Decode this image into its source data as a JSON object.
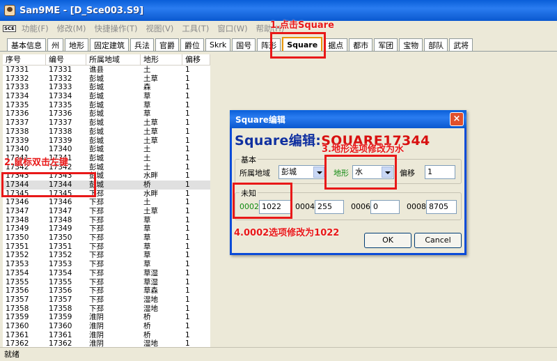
{
  "window": {
    "title": "San9ME - [D_Sce003.S9]"
  },
  "menu": {
    "logo": "SCE",
    "items": [
      "功能(F)",
      "修改(M)",
      "快捷操作(T)",
      "视图(V)",
      "工具(T)",
      "窗口(W)",
      "帮助(H)"
    ]
  },
  "tabs": [
    "基本信息",
    "州",
    "地形",
    "固定建筑",
    "兵法",
    "官爵",
    "爵位",
    "Skrk",
    "国号",
    "阵形",
    "Square",
    "据点",
    "都市",
    "军团",
    "宝物",
    "部队",
    "武将"
  ],
  "active_tab": "Square",
  "list": {
    "columns": [
      "序号",
      "编号",
      "所属地域",
      "地形",
      "偏移"
    ],
    "rows": [
      [
        "17331",
        "17331",
        "谯县",
        "土",
        "1"
      ],
      [
        "17332",
        "17332",
        "彭城",
        "土草",
        "1"
      ],
      [
        "17333",
        "17333",
        "彭城",
        "森",
        "1"
      ],
      [
        "17334",
        "17334",
        "彭城",
        "草",
        "1"
      ],
      [
        "17335",
        "17335",
        "彭城",
        "草",
        "1"
      ],
      [
        "17336",
        "17336",
        "彭城",
        "草",
        "1"
      ],
      [
        "17337",
        "17337",
        "彭城",
        "土草",
        "1"
      ],
      [
        "17338",
        "17338",
        "彭城",
        "土草",
        "1"
      ],
      [
        "17339",
        "17339",
        "彭城",
        "土草",
        "1"
      ],
      [
        "17340",
        "17340",
        "彭城",
        "土",
        "1"
      ],
      [
        "17341",
        "17341",
        "彭城",
        "土",
        "1"
      ],
      [
        "17342",
        "17342",
        "彭城",
        "土",
        "1"
      ],
      [
        "17343",
        "17343",
        "彭城",
        "水畔",
        "1"
      ],
      [
        "17344",
        "17344",
        "彭城",
        "桥",
        "1"
      ],
      [
        "17345",
        "17345",
        "下邳",
        "水畔",
        "1"
      ],
      [
        "17346",
        "17346",
        "下邳",
        "土",
        "1"
      ],
      [
        "17347",
        "17347",
        "下邳",
        "土草",
        "1"
      ],
      [
        "17348",
        "17348",
        "下邳",
        "草",
        "1"
      ],
      [
        "17349",
        "17349",
        "下邳",
        "草",
        "1"
      ],
      [
        "17350",
        "17350",
        "下邳",
        "草",
        "1"
      ],
      [
        "17351",
        "17351",
        "下邳",
        "草",
        "1"
      ],
      [
        "17352",
        "17352",
        "下邳",
        "草",
        "1"
      ],
      [
        "17353",
        "17353",
        "下邳",
        "草",
        "1"
      ],
      [
        "17354",
        "17354",
        "下邳",
        "草湿",
        "1"
      ],
      [
        "17355",
        "17355",
        "下邳",
        "草湿",
        "1"
      ],
      [
        "17356",
        "17356",
        "下邳",
        "草森",
        "1"
      ],
      [
        "17357",
        "17357",
        "下邳",
        "湿地",
        "1"
      ],
      [
        "17358",
        "17358",
        "下邳",
        "湿地",
        "1"
      ],
      [
        "17359",
        "17359",
        "淮阴",
        "桥",
        "1"
      ],
      [
        "17360",
        "17360",
        "淮阴",
        "桥",
        "1"
      ],
      [
        "17361",
        "17361",
        "淮阴",
        "桥",
        "1"
      ],
      [
        "17362",
        "17362",
        "淮阴",
        "湿地",
        "1"
      ]
    ],
    "selected_index": 13
  },
  "status": {
    "text": "就绪"
  },
  "dialog": {
    "title": "Square编辑",
    "heading_prefix": "Square编辑:",
    "heading_id": "SQUARE17344",
    "group_basic": "基本",
    "region_label": "所属地域",
    "region_value": "彭城",
    "terrain_label": "地形",
    "terrain_value": "水",
    "offset_label": "偏移",
    "offset_value": "1",
    "group_unknown": "未知",
    "f0002_label": "0002",
    "f0002_value": "1022",
    "f0004_label": "0004",
    "f0004_value": "255",
    "f0006_label": "0006",
    "f0006_value": "0",
    "f0008_label": "0008",
    "f0008_value": "8705",
    "ok_label": "OK",
    "cancel_label": "Cancel"
  },
  "annotations": {
    "step1": "1.点击Square",
    "step2": "2.鼠标双击左键",
    "step3": "3.地形选项修改为水",
    "step4": "4.0002选项修改为1022"
  },
  "colors": {
    "annotation": "#e81818",
    "title_blue": "#0a5fd8",
    "heading_blue": "#1030a0",
    "label_green": "#108a10"
  }
}
